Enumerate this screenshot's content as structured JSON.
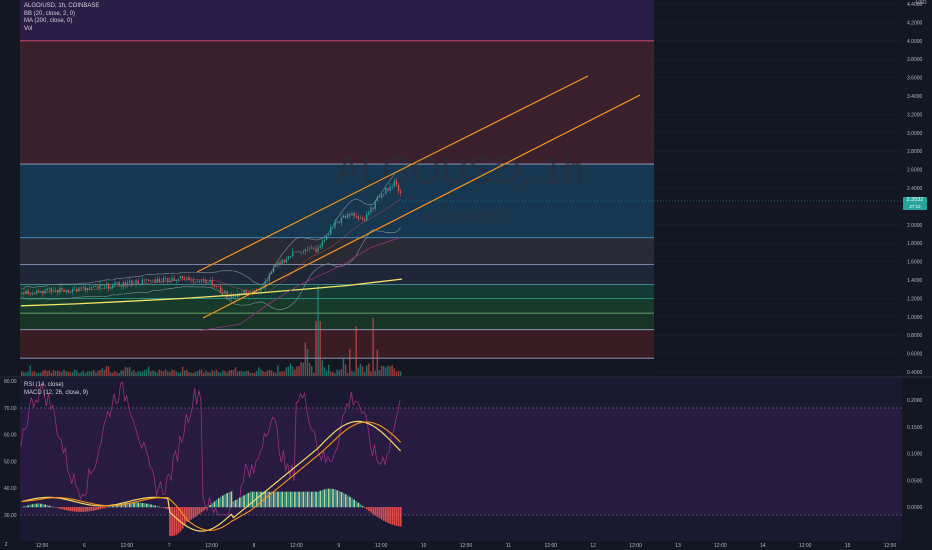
{
  "legend": {
    "symbol_line": "ALGO/USD, 1h, COINBASE",
    "bb": "BB (20, close, 2, 0)",
    "ma": "MA (200, close, 0)",
    "vol": "Vol"
  },
  "rsi_legend": "RSI (14, close)",
  "macd_legend": "MACD (12, 26, close, 9)",
  "watermark": {
    "symbol": "ALGOUSD, 1h",
    "name": "ALGO/USD"
  },
  "currency": "USD",
  "price_badges": {
    "last": "2.3532",
    "sub": "27:12"
  },
  "corner_button": "2",
  "chart_data": [
    {
      "type": "line",
      "title": "ALGOUSD, 1h",
      "price_axis_ticks": [
        "4.4000",
        "4.2000",
        "4.0000",
        "3.8000",
        "3.6000",
        "3.4000",
        "3.2000",
        "3.0000",
        "2.8000",
        "2.6000",
        "2.4000",
        "2.2000",
        "2.0000",
        "1.8000",
        "1.6000",
        "1.4000",
        "1.2000",
        "1.0000",
        "0.8000",
        "0.6000",
        "0.4000"
      ],
      "time_axis_ticks": [
        "12:00",
        "6",
        "12:00",
        "7",
        "12:00",
        "8",
        "12:00",
        "9",
        "12:00",
        "10",
        "12:00",
        "11",
        "12:00",
        "12",
        "12:00",
        "13",
        "12:00",
        "14",
        "12:00",
        "15",
        "12:00"
      ],
      "fib_levels": [
        4.0,
        2.66,
        1.86,
        1.57,
        1.35,
        1.2,
        1.04,
        0.86,
        0.55
      ],
      "series": [
        {
          "name": "BB (20, close, 2, 0)",
          "values": []
        },
        {
          "name": "MA (200, close, 0)",
          "values": [
            1.12,
            1.14,
            1.17,
            1.2,
            1.24,
            1.29,
            1.34,
            1.41
          ]
        }
      ],
      "channel_upper": [
        [
          1.45,
          1.8,
          2.3,
          2.75,
          3.75
        ]
      ],
      "channel_lower": [
        [
          1.02,
          1.4,
          1.9,
          2.4,
          3.5
        ]
      ]
    },
    {
      "type": "line",
      "title": "RSI (14, close)",
      "y_ticks": [
        "80.00",
        "70.00",
        "60.00",
        "50.00",
        "40.00",
        "30.00"
      ],
      "levels": [
        70,
        30
      ]
    },
    {
      "type": "bar",
      "title": "MACD (12, 26, close, 9)",
      "y_ticks": [
        "0.2000",
        "0.1500",
        "0.1000",
        "0.0500",
        "0.0000"
      ]
    }
  ],
  "colors": {
    "background": "#131722",
    "up": "#26a69a",
    "down": "#ef5350",
    "channel": "#f7931a",
    "ma": "#f5e46a",
    "bb": "#7f8f8f",
    "rsi": "#9b2f7d",
    "macd": "#f5d86a",
    "signal": "#f7931a"
  }
}
